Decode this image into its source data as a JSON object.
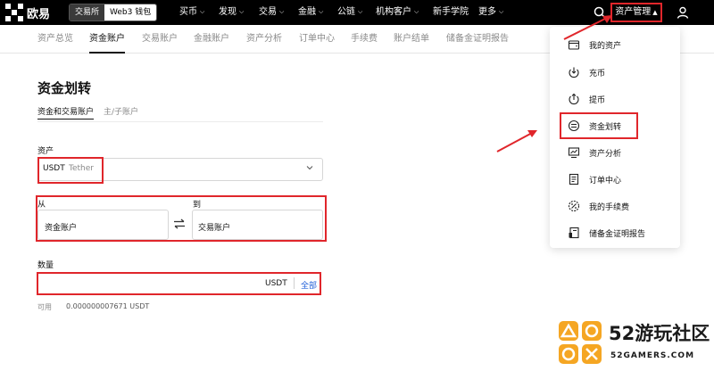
{
  "brand": {
    "name": "欧易"
  },
  "mode_switch": {
    "exchange": "交易所",
    "web3": "Web3 钱包"
  },
  "nav": [
    {
      "label": "买币",
      "chevron": true
    },
    {
      "label": "发现",
      "chevron": true
    },
    {
      "label": "交易",
      "chevron": true
    },
    {
      "label": "金融",
      "chevron": true
    },
    {
      "label": "公链",
      "chevron": true
    },
    {
      "label": "机构客户",
      "chevron": true
    },
    {
      "label": "新手学院",
      "chevron": false
    },
    {
      "label": "更多",
      "chevron": true
    }
  ],
  "asset_management": {
    "label": "资产管理",
    "chevron": "up"
  },
  "subnav": [
    {
      "label": "资产总览",
      "active": false
    },
    {
      "label": "资金账户",
      "active": true
    },
    {
      "label": "交易账户",
      "active": false
    },
    {
      "label": "金融账户",
      "active": false
    },
    {
      "label": "资产分析",
      "active": false
    },
    {
      "label": "订单中心",
      "active": false
    },
    {
      "label": "手续费",
      "active": false
    },
    {
      "label": "账户结单",
      "active": false
    },
    {
      "label": "储备金证明报告",
      "active": false
    }
  ],
  "page": {
    "title": "资金划转",
    "tabs": [
      {
        "label": "资金和交易账户",
        "active": true
      },
      {
        "label": "主/子账户",
        "active": false
      }
    ]
  },
  "form": {
    "asset_label": "资产",
    "asset_code": "USDT",
    "asset_name": "Tether",
    "from_label": "从",
    "to_label": "到",
    "from_account": "资金账户",
    "to_account": "交易账户",
    "amount_label": "数量",
    "amount_value": "",
    "amount_unit": "USDT",
    "amount_all": "全部",
    "available_label": "可用",
    "available_value": "0.000000007671 USDT"
  },
  "dropdown": {
    "items": [
      {
        "label": "我的资产",
        "icon": "wallet-icon"
      },
      {
        "label": "充币",
        "icon": "deposit-icon"
      },
      {
        "label": "提币",
        "icon": "withdraw-icon"
      },
      {
        "label": "资金划转",
        "icon": "transfer-icon",
        "highlighted": true
      },
      {
        "label": "资产分析",
        "icon": "analysis-icon"
      },
      {
        "label": "订单中心",
        "icon": "orders-icon"
      },
      {
        "label": "我的手续费",
        "icon": "fee-icon"
      },
      {
        "label": "储备金证明报告",
        "icon": "report-icon"
      }
    ]
  },
  "watermark": {
    "text": "52游玩社区",
    "sub": "52GAMERS.COM"
  },
  "colors": {
    "highlight": "#e0262b",
    "topbar": "#000000",
    "link": "#1f5fd8"
  }
}
